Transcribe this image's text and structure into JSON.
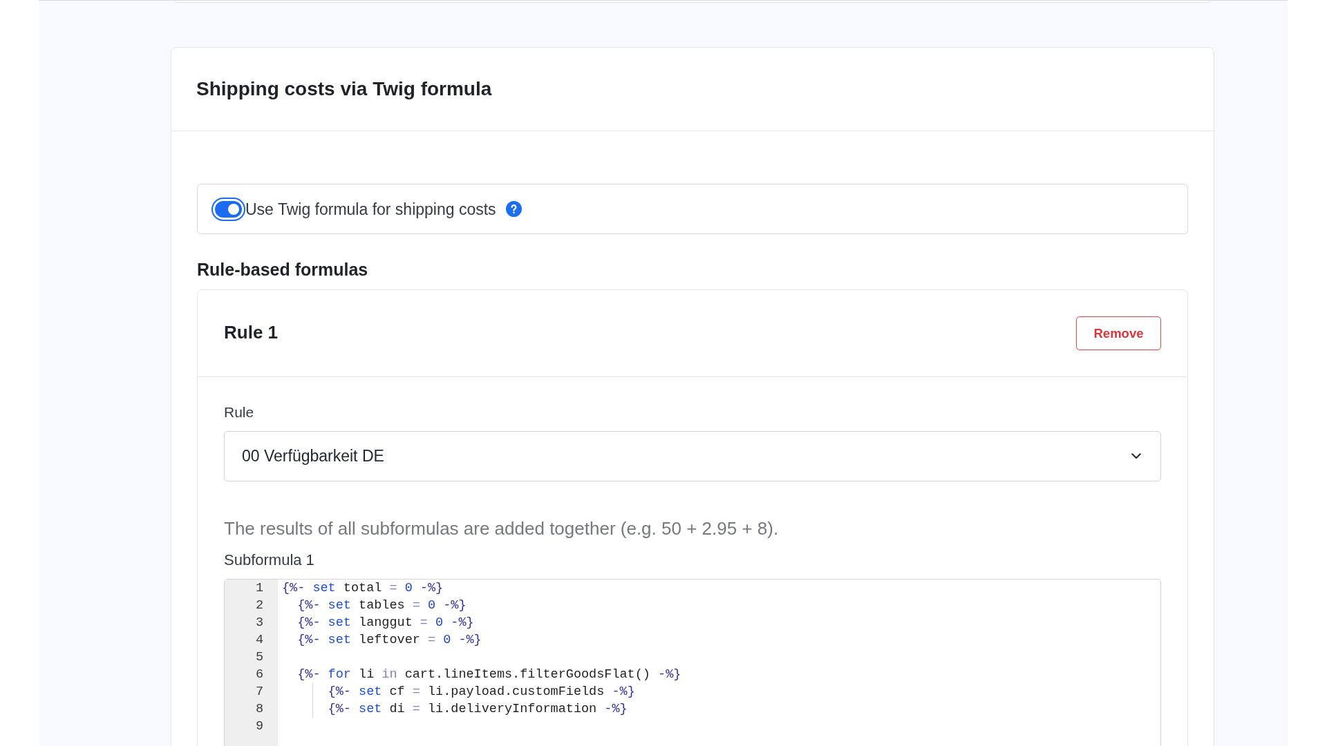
{
  "card": {
    "title": "Shipping costs via Twig formula"
  },
  "toggle": {
    "label": "Use Twig formula for shipping costs",
    "on": true,
    "focused": true
  },
  "section_title": "Rule-based formulas",
  "rules": [
    {
      "title": "Rule 1",
      "remove_button": "Remove",
      "rule_field": {
        "label": "Rule",
        "value": "00 Verfügbarkeit DE"
      },
      "hint": "The results of all subformulas are added together (e.g. 50 + 2.95 + 8).",
      "subformulas": [
        {
          "label": "Subformula 1",
          "lines": [
            {
              "number": "1",
              "tokens": [
                {
                  "text": "{%-",
                  "kind": "tag"
                },
                {
                  "text": " set",
                  "kind": "keyword"
                },
                {
                  "text": " total",
                  "kind": "text"
                },
                {
                  "text": " =",
                  "kind": "operator"
                },
                {
                  "text": " 0",
                  "kind": "number"
                },
                {
                  "text": " -%}",
                  "kind": "tag"
                }
              ]
            },
            {
              "number": "2",
              "tokens": [
                {
                  "text": "  {%-",
                  "kind": "tag"
                },
                {
                  "text": " set",
                  "kind": "keyword"
                },
                {
                  "text": " tables",
                  "kind": "text"
                },
                {
                  "text": " =",
                  "kind": "operator"
                },
                {
                  "text": " 0",
                  "kind": "number"
                },
                {
                  "text": " -%}",
                  "kind": "tag"
                }
              ]
            },
            {
              "number": "3",
              "tokens": [
                {
                  "text": "  {%-",
                  "kind": "tag"
                },
                {
                  "text": " set",
                  "kind": "keyword"
                },
                {
                  "text": " langgut",
                  "kind": "text"
                },
                {
                  "text": " =",
                  "kind": "operator"
                },
                {
                  "text": " 0",
                  "kind": "number"
                },
                {
                  "text": " -%}",
                  "kind": "tag"
                }
              ]
            },
            {
              "number": "4",
              "tokens": [
                {
                  "text": "  {%-",
                  "kind": "tag"
                },
                {
                  "text": " set",
                  "kind": "keyword"
                },
                {
                  "text": " leftover",
                  "kind": "text"
                },
                {
                  "text": " =",
                  "kind": "operator"
                },
                {
                  "text": " 0",
                  "kind": "number"
                },
                {
                  "text": " -%}",
                  "kind": "tag"
                }
              ]
            },
            {
              "number": "5"
            },
            {
              "number": "6",
              "tokens": [
                {
                  "text": "  {%-",
                  "kind": "tag"
                },
                {
                  "text": " for",
                  "kind": "keyword"
                },
                {
                  "text": " li",
                  "kind": "text"
                },
                {
                  "text": " in",
                  "kind": "operator"
                },
                {
                  "text": " cart.lineItems.filterGoodsFlat()",
                  "kind": "text"
                },
                {
                  "text": " -%}",
                  "kind": "tag"
                }
              ]
            },
            {
              "number": "7",
              "tokens": [
                {
                  "text": "      {%-",
                  "kind": "tag"
                },
                {
                  "text": " set",
                  "kind": "keyword"
                },
                {
                  "text": " cf",
                  "kind": "text"
                },
                {
                  "text": " =",
                  "kind": "operator"
                },
                {
                  "text": " li.payload.customFields",
                  "kind": "text"
                },
                {
                  "text": " -%}",
                  "kind": "tag"
                }
              ]
            },
            {
              "number": "8",
              "tokens": [
                {
                  "text": "      {%-",
                  "kind": "tag"
                },
                {
                  "text": " set",
                  "kind": "keyword"
                },
                {
                  "text": " di",
                  "kind": "text"
                },
                {
                  "text": " =",
                  "kind": "operator"
                },
                {
                  "text": " li.deliveryInformation",
                  "kind": "text"
                },
                {
                  "text": " -%}",
                  "kind": "tag"
                }
              ]
            },
            {
              "number": "9"
            }
          ]
        }
      ]
    }
  ]
}
